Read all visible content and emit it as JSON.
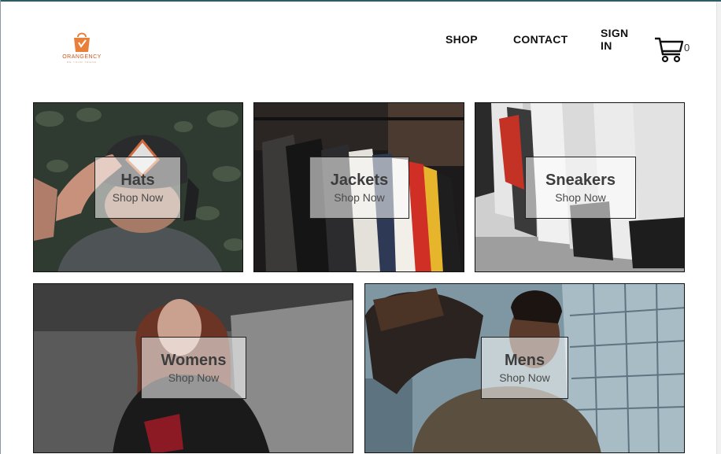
{
  "brand": {
    "name": "ORANGENCY",
    "tagline": "BE YOUR TREND"
  },
  "nav": {
    "shop": "SHOP",
    "contact": "CONTACT",
    "sign_in": "SIGN IN"
  },
  "cart": {
    "count": "0",
    "icon": "cart-icon"
  },
  "categories": [
    {
      "title": "Hats",
      "cta": "Shop Now"
    },
    {
      "title": "Jackets",
      "cta": "Shop Now"
    },
    {
      "title": "Sneakers",
      "cta": "Shop Now"
    },
    {
      "title": "Womens",
      "cta": "Shop Now"
    },
    {
      "title": "Mens",
      "cta": "Shop Now"
    }
  ],
  "colors": {
    "brand_orange": "#e8803a",
    "nav_text": "#111111"
  }
}
